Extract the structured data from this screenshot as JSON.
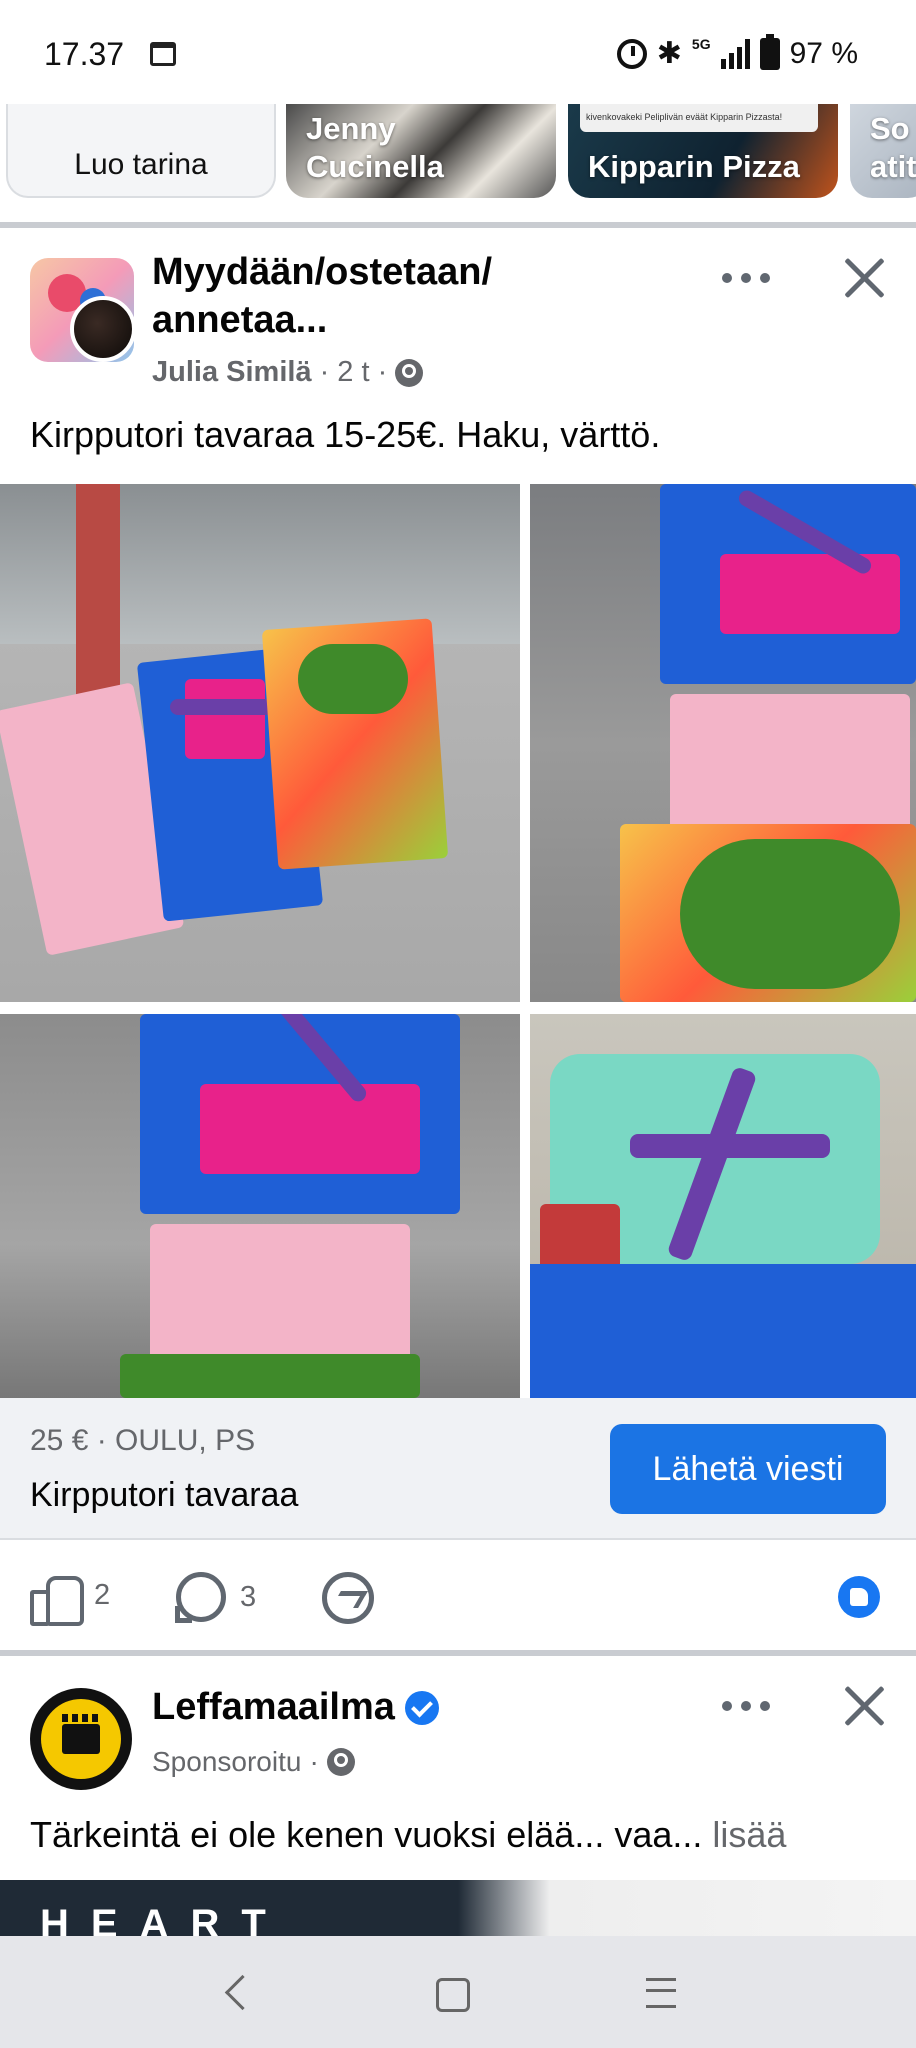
{
  "status_bar": {
    "time": "17.37",
    "network": "5G",
    "battery": "97 %"
  },
  "stories": [
    {
      "label": "Luo tarina"
    },
    {
      "label": "Jenny Cucinella"
    },
    {
      "label": "Kipparin Pizza",
      "card_text": "kivenkovakeki Peliplivän eväät Kipparin Pizzasta!"
    },
    {
      "label": "So atit"
    }
  ],
  "post": {
    "group_name": "Myydään/ostetaan/ annetaa...",
    "author": "Julia Similä",
    "time": "· 2 t ·",
    "text": "Kirpputori tavaraa 15-25€. Haku, värttö.",
    "listing": {
      "price_location": "25 € · OULU, PS",
      "title": "Kirpputori tavaraa",
      "button_label": "Lähetä viesti"
    },
    "actions": {
      "like_count": "2",
      "comment_count": "3"
    }
  },
  "sponsored_post": {
    "page_name": "Leffamaailma",
    "sponsored_label": "Sponsoroitu",
    "dot": "·",
    "text": "Tärkeintä ei ole kenen vuoksi elää... vaa...",
    "more_label": "lisää",
    "media_text": "HEART"
  },
  "icons": {
    "like": "like-icon",
    "comment": "comment-icon",
    "messenger": "messenger-icon",
    "more": "more-options-icon",
    "close": "close-icon",
    "globe": "globe-icon",
    "verified": "verified-badge-icon"
  },
  "colors": {
    "brand_blue": "#1b74e4",
    "text_primary": "#050505",
    "text_secondary": "#65676b",
    "listing_bg": "#f0f2f5"
  }
}
